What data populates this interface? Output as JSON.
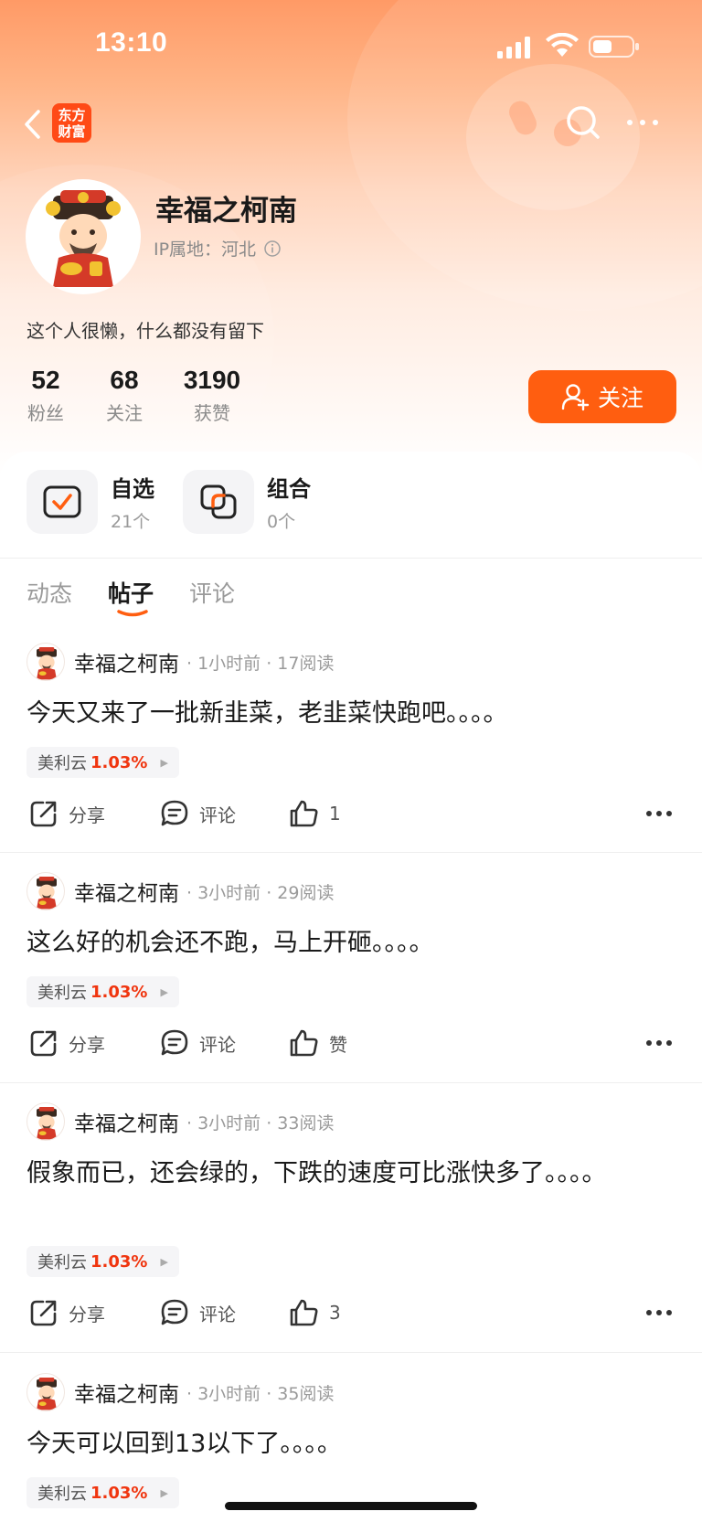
{
  "status_bar": {
    "time": "13:10"
  },
  "nav": {
    "brand_logo_text": "东方财富"
  },
  "profile": {
    "name": "幸福之柯南",
    "ip_location": "IP属地：河北",
    "bio": "这个人很懒，什么都没有留下",
    "stats": [
      {
        "value": "52",
        "label": "粉丝"
      },
      {
        "value": "68",
        "label": "关注"
      },
      {
        "value": "3190",
        "label": "获赞"
      }
    ],
    "follow_label": "关注"
  },
  "quick_links": [
    {
      "title": "自选",
      "subtitle": "21个",
      "icon": "checkbox-icon"
    },
    {
      "title": "组合",
      "subtitle": "0个",
      "icon": "combo-icon"
    }
  ],
  "tabs": [
    {
      "label": "动态"
    },
    {
      "label": "帖子",
      "active": true
    },
    {
      "label": "评论"
    }
  ],
  "posts": [
    {
      "author": "幸福之柯南",
      "meta": "· 1小时前 · 17阅读",
      "text": "今天又来了一批新韭菜，老韭菜快跑吧。。。。",
      "stock": {
        "name": "美利云",
        "change": "1.03%"
      },
      "share": "分享",
      "comment": "评论",
      "like": "1"
    },
    {
      "author": "幸福之柯南",
      "meta": "· 3小时前 · 29阅读",
      "text": "这么好的机会还不跑，马上开砸。。。。",
      "stock": {
        "name": "美利云",
        "change": "1.03%"
      },
      "share": "分享",
      "comment": "评论",
      "like": "赞"
    },
    {
      "author": "幸福之柯南",
      "meta": "· 3小时前 · 33阅读",
      "text": "假象而已，还会绿的，下跌的速度可比涨快多了。。。。",
      "stock": {
        "name": "美利云",
        "change": "1.03%"
      },
      "share": "分享",
      "comment": "评论",
      "like": "3"
    },
    {
      "author": "幸福之柯南",
      "meta": "· 3小时前 · 35阅读",
      "text": "今天可以回到13以下了。。。。",
      "stock": {
        "name": "美利云",
        "change": "1.03%"
      }
    }
  ],
  "colors": {
    "accent": "#ff5e10",
    "stock_up": "#f0350f",
    "brand": "#ff4a16"
  }
}
